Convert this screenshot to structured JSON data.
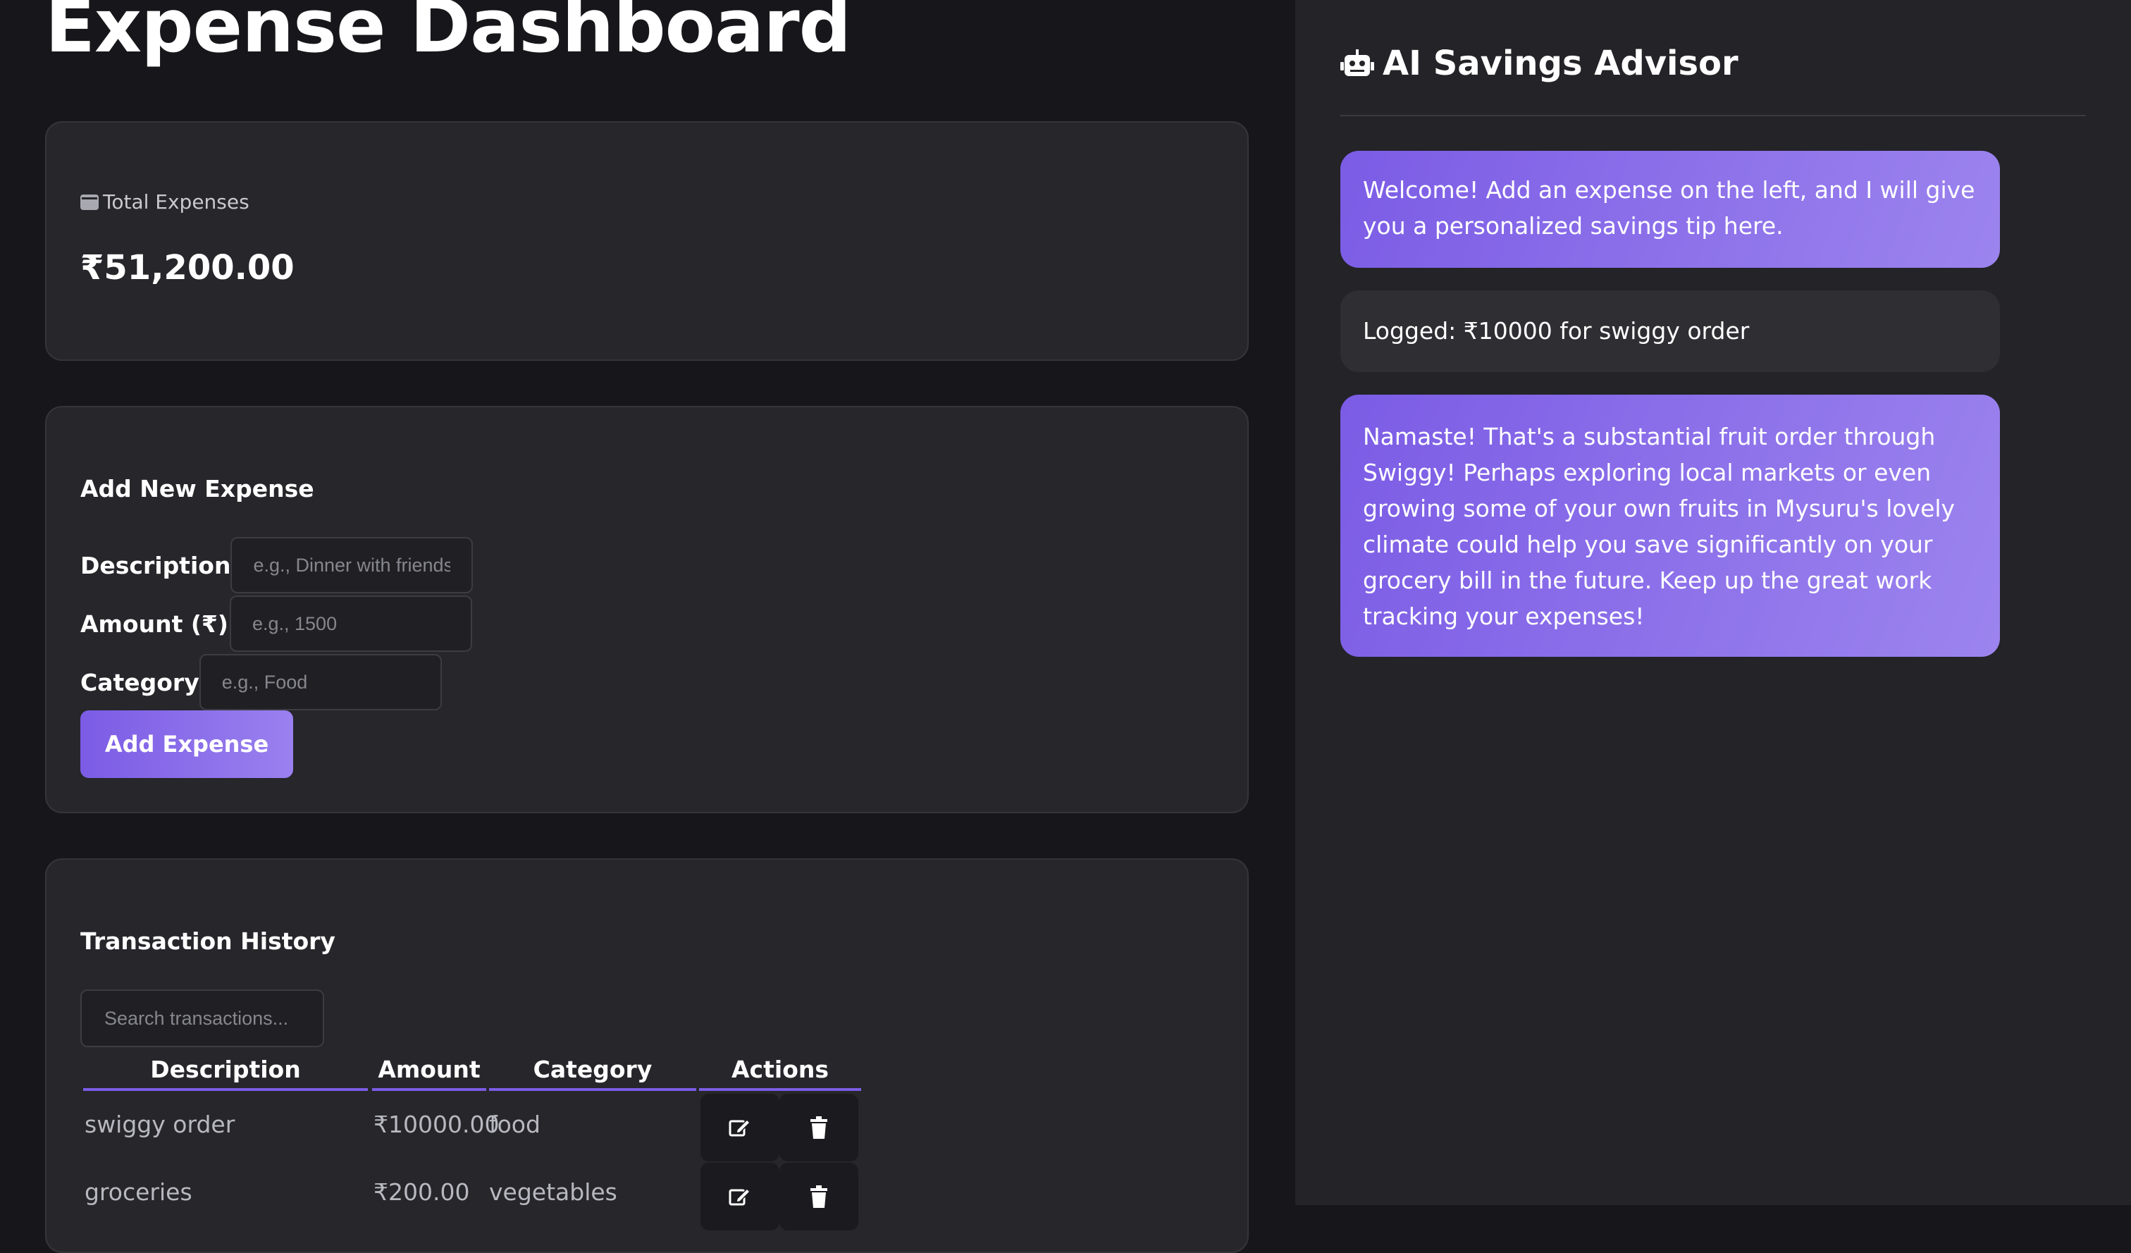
{
  "app": {
    "title": "Expense Dashboard"
  },
  "summary": {
    "label": "Total Expenses",
    "value": "₹51,200.00"
  },
  "form": {
    "heading": "Add New Expense",
    "description_label": "Description",
    "description_placeholder": "e.g., Dinner with friends",
    "amount_label": "Amount (₹)",
    "amount_placeholder": "e.g., 1500",
    "category_label": "Category",
    "category_placeholder": "e.g., Food",
    "submit_label": "Add Expense"
  },
  "transactions": {
    "heading": "Transaction History",
    "search_placeholder": "Search transactions...",
    "columns": [
      "Description",
      "Amount",
      "Category",
      "Actions"
    ],
    "rows": [
      {
        "description": "swiggy order",
        "amount": "₹10000.00",
        "category": "food"
      },
      {
        "description": "groceries",
        "amount": "₹200.00",
        "category": "vegetables"
      }
    ]
  },
  "advisor": {
    "title": "AI Savings Advisor",
    "messages": [
      {
        "role": "ai",
        "text": "Welcome! Add an expense on the left, and I will give you a personalized savings tip here."
      },
      {
        "role": "user",
        "text": "Logged: ₹10000 for swiggy order"
      },
      {
        "role": "ai",
        "text": "Namaste! That's a substantial fruit order through Swiggy! Perhaps exploring local markets or even growing some of your own fruits in Mysuru's lovely climate could help you save significantly on your grocery bill in the future. Keep up the great work tracking your expenses!"
      }
    ]
  },
  "icons": {
    "wallet": "wallet-icon",
    "robot": "robot-icon",
    "edit": "edit-icon",
    "delete": "trash-icon"
  },
  "colors": {
    "accent": "#7b5ce5",
    "accent_light": "#9a80ef",
    "background": "#17171b",
    "panel": "#232328"
  }
}
